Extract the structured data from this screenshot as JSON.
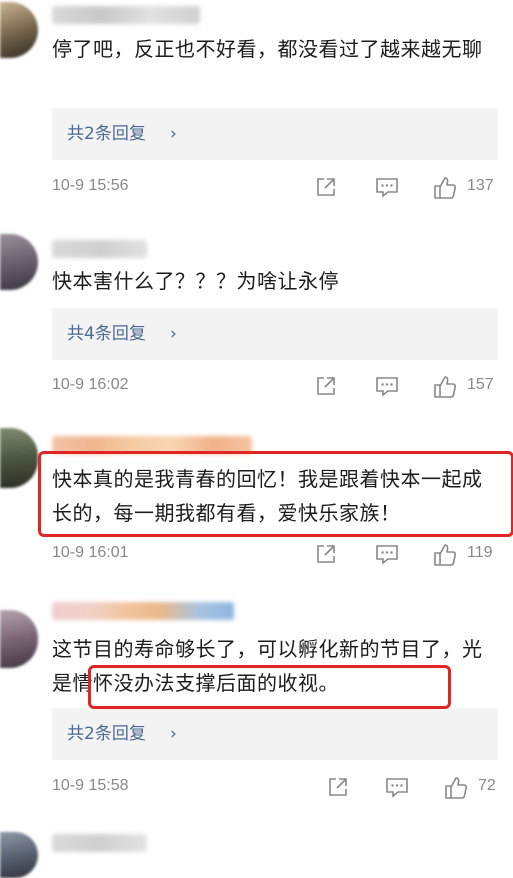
{
  "comments": [
    {
      "text": "停了吧，反正也不好看，都没看过了越来越无聊",
      "reply_label": "共2条回复",
      "time": "10-9 15:56",
      "likes": "137"
    },
    {
      "text": "快本害什么了？？？为啥让永停",
      "reply_label": "共4条回复",
      "time": "10-9 16:02",
      "likes": "157"
    },
    {
      "text": "快本真的是我青春的回忆！我是跟着快本一起成长的，每一期我都有看，爱快乐家族！",
      "time": "10-9 16:01",
      "likes": "119"
    },
    {
      "text_part1": "这节目的寿命够长了，可以孵化新的节目了，",
      "text_part2": "光是情怀没办法支撑后面的收视。",
      "reply_label": "共2条回复",
      "time": "10-9 15:58",
      "likes": "72"
    }
  ],
  "icons": {
    "share": "share-icon",
    "comment": "comment-icon",
    "like": "thumb-up-icon",
    "chevron": "chevron-right-icon"
  },
  "colors": {
    "link": "#4a6a93",
    "highlight": "#e02525",
    "meta": "#888888"
  }
}
